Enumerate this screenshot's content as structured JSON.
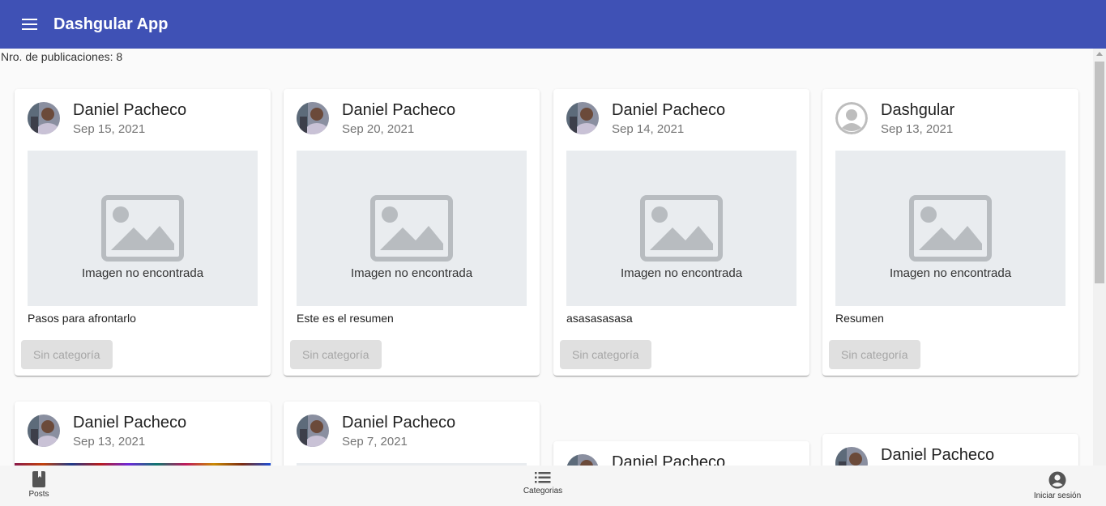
{
  "app": {
    "title": "Dashgular App"
  },
  "posts_count_text": "Nro. de publicaciones: 8",
  "image_placeholder_text": "Imagen no encontrada",
  "posts": [
    {
      "author": "Daniel Pacheco",
      "date": "Sep 15, 2021",
      "summary": "Pasos para afrontarlo",
      "category": "Sin categoría",
      "avatar": "photo-avatar"
    },
    {
      "author": "Daniel Pacheco",
      "date": "Sep 20, 2021",
      "summary": "Este es el resumen",
      "category": "Sin categoría",
      "avatar": "photo-avatar"
    },
    {
      "author": "Daniel Pacheco",
      "date": "Sep 14, 2021",
      "summary": "asasasasasa",
      "category": "Sin categoría",
      "avatar": "photo-avatar"
    },
    {
      "author": "Dashgular",
      "date": "Sep 13, 2021",
      "summary": "Resumen",
      "category": "Sin categoría",
      "avatar": "default-user-avatar"
    },
    {
      "author": "Daniel Pacheco",
      "date": "Sep 13, 2021",
      "avatar": "photo-avatar"
    },
    {
      "author": "Daniel Pacheco",
      "date": "Sep 7, 2021",
      "avatar": "photo-avatar"
    },
    {
      "author": "Daniel Pacheco",
      "avatar": "photo-avatar"
    },
    {
      "author": "Daniel Pacheco",
      "avatar": "photo-avatar"
    }
  ],
  "bottom_nav": [
    {
      "label": "Posts",
      "icon": "book-icon"
    },
    {
      "label": "Categorias",
      "icon": "list-icon"
    },
    {
      "label": "Iniciar sesión",
      "icon": "account-circle-icon"
    }
  ],
  "colors": {
    "toolbar": "#3f51b5",
    "background": "#fafafa",
    "placeholder_bg": "#e9ecef"
  }
}
